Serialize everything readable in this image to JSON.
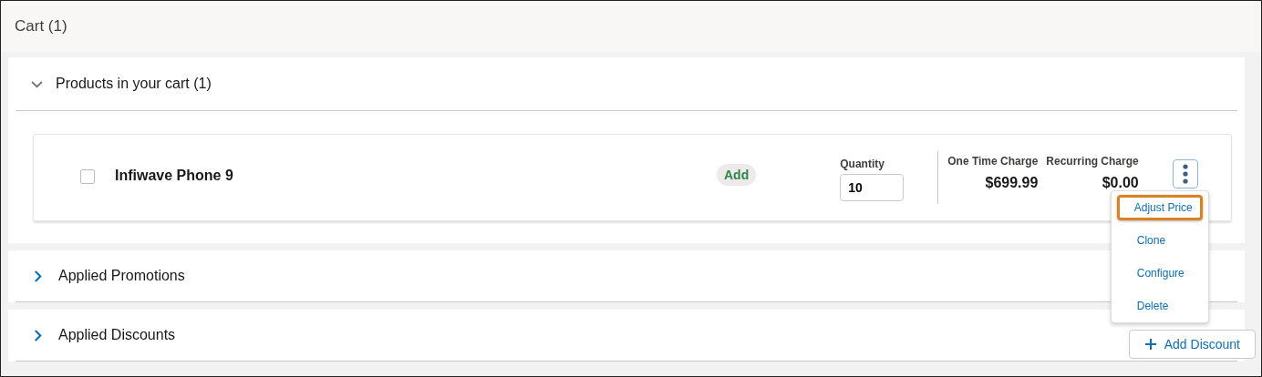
{
  "page": {
    "title": "Cart (1)"
  },
  "sections": [
    {
      "title": "Products in your cart (1)",
      "expanded": true,
      "products": [
        {
          "name": "Infiwave Phone 9",
          "checked": false,
          "badge": "Add",
          "quantity_label": "Quantity",
          "quantity": "10",
          "charges": [
            {
              "label": "One Time Charge",
              "value": "$699.99"
            },
            {
              "label": "Recurring Charge",
              "value": "$0.00"
            }
          ],
          "menu": {
            "open": true,
            "items": [
              {
                "label": "Adjust Price",
                "selected": true
              },
              {
                "label": "Clone",
                "selected": false
              },
              {
                "label": "Configure",
                "selected": false
              },
              {
                "label": "Delete",
                "selected": false
              }
            ]
          }
        }
      ]
    },
    {
      "title": "Applied Promotions",
      "expanded": false
    },
    {
      "title": "Applied Discounts",
      "expanded": false,
      "button": "Add Discount"
    }
  ]
}
